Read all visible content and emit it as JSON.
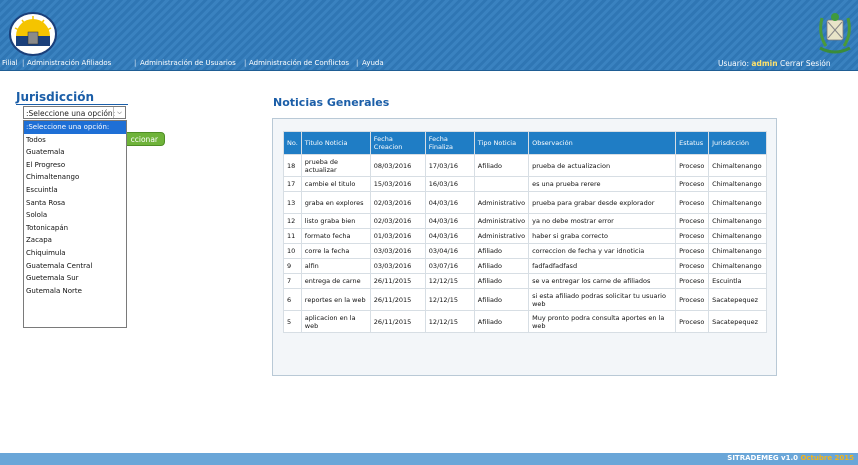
{
  "header": {
    "nav": [
      "Filial",
      "Administración Afiliados",
      "Administración de Usuarios",
      "Administración de Conflictos",
      "Ayuda"
    ],
    "user_label": "Usuario:",
    "user_name": "admin",
    "logout": "Cerrar Sesión"
  },
  "sidebar": {
    "title": "Jurisdicción",
    "select_value": ":Seleccione una opción:",
    "options": [
      ":Seleccione una opción:",
      "Todos",
      "Guatemala",
      "El Progreso",
      "Chimaltenango",
      "Escuintla",
      "Santa Rosa",
      "Solola",
      "Totonicapán",
      "Zacapa",
      "Chiquimula",
      "Guatemala Central",
      "Guetemala Sur",
      "Gutemala Norte"
    ],
    "button_label": "ccionar"
  },
  "main": {
    "title": "Noticias Generales",
    "columns": [
      "No.",
      "Titulo Noticia",
      "Fecha Creacion",
      "Fecha Finaliza",
      "Tipo Noticia",
      "Observación",
      "Estatus",
      "Jurisdicción"
    ],
    "rows": [
      [
        "18",
        "prueba de actualizar",
        "08/03/2016",
        "17/03/16",
        "Afiliado",
        "prueba de actualizacion",
        "Proceso",
        "Chimaltenango"
      ],
      [
        "17",
        "cambie el titulo",
        "15/03/2016",
        "16/03/16",
        "",
        "es una prueba rerere",
        "Proceso",
        "Chimaltenango"
      ],
      [
        "13",
        "graba en explores",
        "02/03/2016",
        "04/03/16",
        "Administrativo",
        "prueba para grabar desde explorador",
        "Proceso",
        "Chimaltenango"
      ],
      [
        "12",
        "listo graba bien",
        "02/03/2016",
        "04/03/16",
        "Administrativo",
        "ya no debe mostrar error",
        "Proceso",
        "Chimaltenango"
      ],
      [
        "11",
        "formato fecha",
        "01/03/2016",
        "04/03/16",
        "Administrativo",
        "haber si graba correcto",
        "Proceso",
        "Chimaltenango"
      ],
      [
        "10",
        "corre la fecha",
        "03/03/2016",
        "03/04/16",
        "Afiliado",
        "correccion de fecha y var idnoticia",
        "Proceso",
        "Chimaltenango"
      ],
      [
        "9",
        "alfin",
        "03/03/2016",
        "03/07/16",
        "Afiliado",
        "fadfadfadfasd",
        "Proceso",
        "Chimaltenango"
      ],
      [
        "7",
        "entrega de carne",
        "26/11/2015",
        "12/12/15",
        "Afiliado",
        "se va entregar los carne de afiliados",
        "Proceso",
        "Escuintla"
      ],
      [
        "6",
        "reportes en la web",
        "26/11/2015",
        "12/12/15",
        "Afiliado",
        "si esta afiliado podras solicitar tu usuario web",
        "Proceso",
        "Sacatepequez"
      ],
      [
        "5",
        "aplicacion en la web",
        "26/11/2015",
        "12/12/15",
        "Afiliado",
        "Muy pronto podra consulta aportes en la web",
        "Proceso",
        "Sacatepequez"
      ]
    ]
  },
  "footer": {
    "app": "SITRADEMEG v1.0",
    "date": "Octubre 2015"
  }
}
